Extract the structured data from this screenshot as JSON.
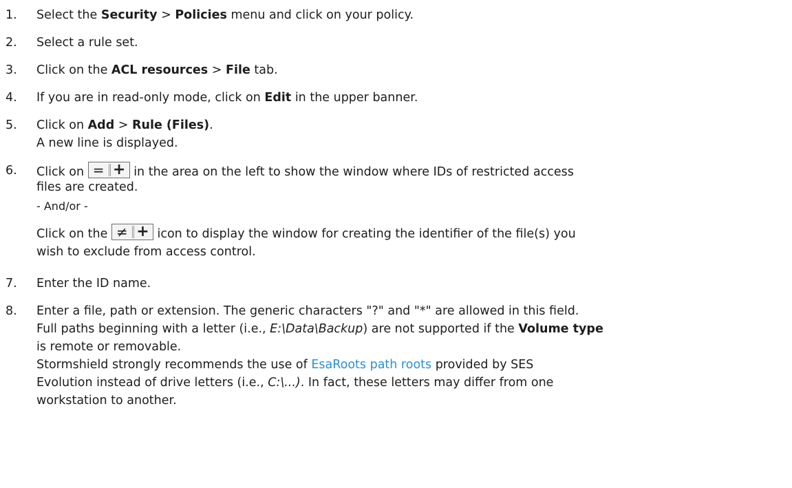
{
  "steps": [
    {
      "num": "1.",
      "t1": "Select the ",
      "b1": "Security",
      "t2": " > ",
      "b2": "Policies",
      "t3": " menu and click on your policy."
    },
    {
      "num": "2.",
      "t1": "Select a rule set."
    },
    {
      "num": "3.",
      "t1": "Click on the ",
      "b1": "ACL resources",
      "t2": " > ",
      "b2": "File",
      "t3": " tab."
    },
    {
      "num": "4.",
      "t1": "If you are in read-only mode, click on ",
      "b1": "Edit",
      "t2": " in the upper banner."
    },
    {
      "num": "5.",
      "t1": "Click on ",
      "b1": "Add",
      "t2": " > ",
      "b2": "Rule (Files)",
      "t3": ".",
      "line2": "A new line is displayed."
    },
    {
      "num": "6.",
      "t1": "Click on ",
      "t2": " in the area on the left to show the window where IDs of restricted access",
      "line2": "files are created.",
      "line3": "- And/or -",
      "t4": "Click on the ",
      "t5": " icon to display the window for creating the identifier of the file(s) you",
      "line5": "wish to exclude from access control.",
      "icon1_left": "=",
      "icon1_right": "+",
      "icon2_left": "≠",
      "icon2_right": "+"
    },
    {
      "num": "7.",
      "t1": "Enter the ID name."
    },
    {
      "num": "8.",
      "l1": "Enter a file, path or extension. The generic characters \"?\" and \"*\" are allowed in this field.",
      "l2a": "Full paths beginning with a letter (i.e., ",
      "l2i": "E:\\Data\\Backup",
      "l2b": ") are not supported if the ",
      "l2bold": "Volume type",
      "l3": "is remote or removable.",
      "l4a": "Stormshield strongly recommends the use of ",
      "l4link": "EsaRoots path roots",
      "l4b": " provided by SES",
      "l5a": "Evolution instead of drive letters (i.e., ",
      "l5i": "C:\\...)",
      "l5b": ". In fact, these letters may differ from one",
      "l6": "workstation to another."
    }
  ],
  "colors": {
    "link": "#2f8fd0",
    "text": "#1d1d1d"
  },
  "icons": [
    "add-included-file-id-icon",
    "add-excluded-file-id-icon"
  ]
}
